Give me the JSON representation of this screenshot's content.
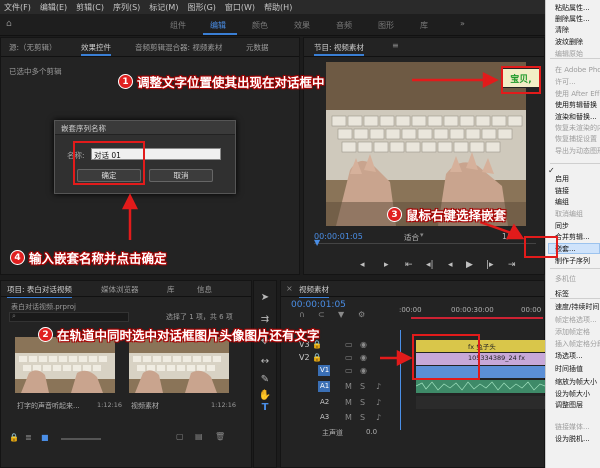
{
  "menubar": {
    "items": [
      "文件(F)",
      "编辑(E)",
      "剪辑(C)",
      "序列(S)",
      "标记(M)",
      "图形(G)",
      "窗口(W)",
      "帮助(H)"
    ]
  },
  "workspaces": {
    "items": [
      "组件",
      "编辑",
      "颜色",
      "效果",
      "音频",
      "图形",
      "库"
    ],
    "active": "编辑"
  },
  "source_panel": {
    "source_label": "源:（无剪辑）",
    "tabs": [
      "效果控件",
      "音频剪辑混合器: 视频素材",
      "元数据"
    ],
    "message": "已选中多个剪辑"
  },
  "program_monitor": {
    "title": "节目: 视频素材",
    "speech_bubble": "宝贝,",
    "timecode": "00:00:01:05",
    "fit": "适合",
    "fraction": "1/2"
  },
  "dialog": {
    "title": "嵌套序列名称",
    "field_label": "名称:",
    "name_value": "对话 01",
    "ok_label": "确定",
    "cancel_label": "取消"
  },
  "project_panel": {
    "tabs": [
      "项目: 表白对话视频",
      "媒体浏览器",
      "库",
      "信息"
    ],
    "project_file": "表白对话视频.prproj",
    "item_count": "选择了 1 项，共 6 项",
    "clips": [
      {
        "name": "打字的声音听起来...",
        "duration": "1:12:16"
      },
      {
        "name": "视频素材",
        "duration": "1:12:16"
      }
    ]
  },
  "timeline": {
    "title": "视频素材",
    "timecode": "00:00:01:05",
    "ruler_labels": [
      ":00:00",
      "00:00:30:00",
      "00:00"
    ],
    "video_tracks": [
      "V3",
      "V2",
      "V1"
    ],
    "audio_tracks": [
      "A1",
      "A2",
      "A3"
    ],
    "master_label": "主声道",
    "master_value": "0.0",
    "clip_labels": [
      "fx 兔子头",
      "105334389_24 fx"
    ]
  },
  "context_menu": {
    "items": [
      {
        "label": "粘贴属性...",
        "disabled": false
      },
      {
        "label": "删除属性...",
        "disabled": false
      },
      {
        "label": "清除",
        "disabled": false
      },
      {
        "label": "波纹删除",
        "disabled": false
      },
      {
        "label": "编辑原始",
        "disabled": true
      },
      {
        "label": "在 Adobe Pho",
        "disabled": true
      },
      {
        "label": "许可...",
        "disabled": true
      },
      {
        "label": "使用 After Effe",
        "disabled": true
      },
      {
        "label": "使用剪辑替换",
        "disabled": false
      },
      {
        "label": "渲染和替换...",
        "disabled": false
      },
      {
        "label": "恢复未渲染的内",
        "disabled": true
      },
      {
        "label": "恢复捕捉设置",
        "disabled": true
      },
      {
        "label": "导出为动态图形",
        "disabled": true
      },
      {
        "label": "启用",
        "disabled": false
      },
      {
        "label": "链接",
        "disabled": false
      },
      {
        "label": "编组",
        "disabled": false
      },
      {
        "label": "取消编组",
        "disabled": true
      },
      {
        "label": "同步",
        "disabled": false
      },
      {
        "label": "合并剪辑...",
        "disabled": false
      },
      {
        "label": "嵌套...",
        "disabled": false
      },
      {
        "label": "制作子序列",
        "disabled": false
      },
      {
        "label": "多机位",
        "disabled": true
      },
      {
        "label": "标签",
        "disabled": false
      },
      {
        "label": "速度/持续时间",
        "disabled": false
      },
      {
        "label": "帧定格选项...",
        "disabled": true
      },
      {
        "label": "添加帧定格",
        "disabled": true
      },
      {
        "label": "插入帧定格分段",
        "disabled": true
      },
      {
        "label": "场选项...",
        "disabled": false
      },
      {
        "label": "时间插值",
        "disabled": false
      },
      {
        "label": "缩放为帧大小",
        "disabled": false
      },
      {
        "label": "设为帧大小",
        "disabled": false
      },
      {
        "label": "调整图层",
        "disabled": false
      },
      {
        "label": "链接媒体...",
        "disabled": true
      },
      {
        "label": "设为脱机...",
        "disabled": false
      }
    ],
    "checkmark": "✓"
  },
  "annotations": [
    {
      "num": "1",
      "text": "调整文字位置使其出现在对话框中"
    },
    {
      "num": "2",
      "text": "在轨道中同时选中对话框图片头像图片还有文字"
    },
    {
      "num": "3",
      "text": "鼠标右键选择嵌套"
    },
    {
      "num": "4",
      "text": "输入嵌套名称并点击确定"
    }
  ],
  "colors": {
    "accent": "#3a7fd5",
    "annotation_red": "#e21b1b",
    "panel": "#232323",
    "menu_bg": "#f1f1f1"
  }
}
